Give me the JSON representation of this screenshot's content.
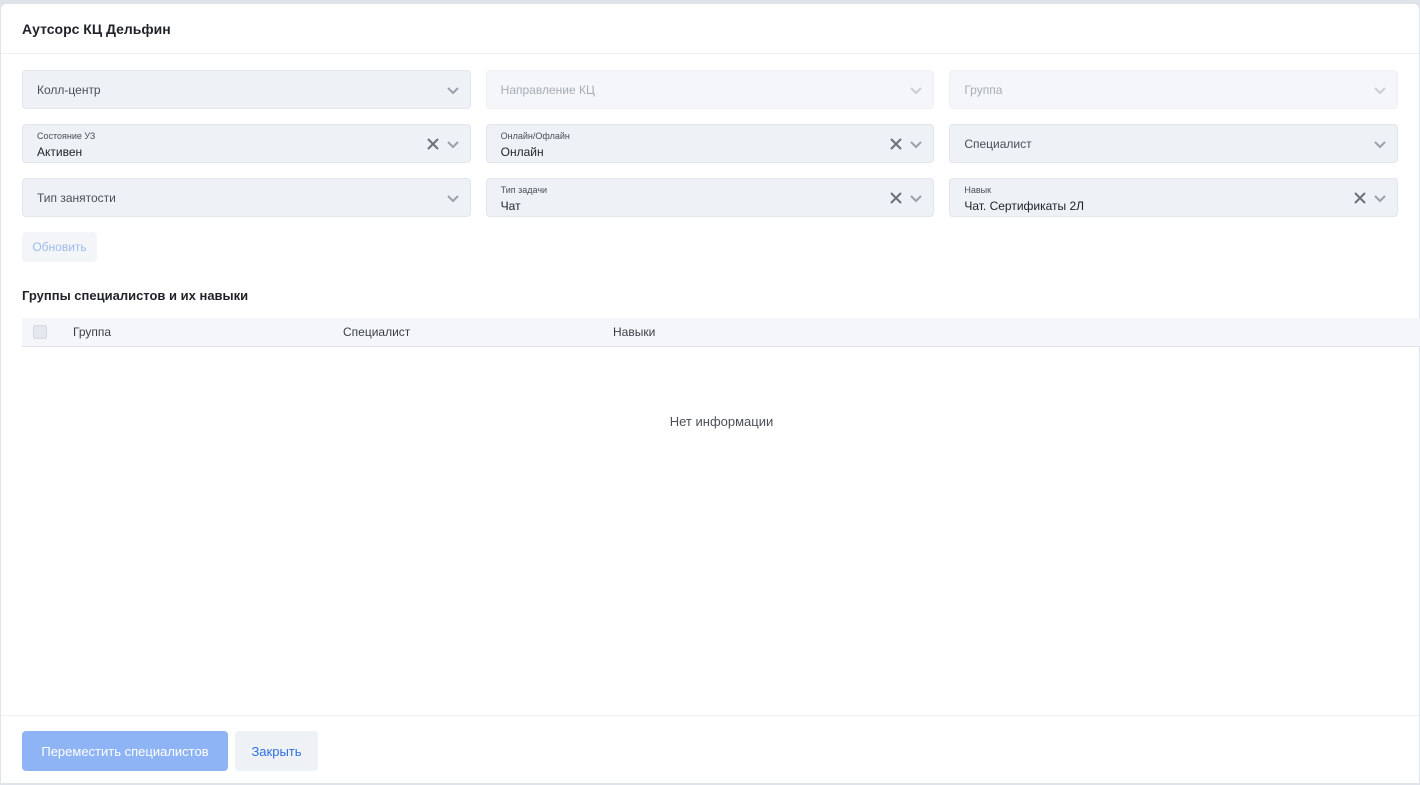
{
  "modal": {
    "title": "Аутсорс КЦ Дельфин"
  },
  "filters": {
    "call_center": {
      "placeholder": "Колл-центр"
    },
    "direction": {
      "placeholder": "Направление КЦ"
    },
    "group": {
      "placeholder": "Группа"
    },
    "state": {
      "label": "Состояние УЗ",
      "value": "Активен"
    },
    "online": {
      "label": "Онлайн/Офлайн",
      "value": "Онлайн"
    },
    "specialist": {
      "placeholder": "Специалист"
    },
    "employment": {
      "placeholder": "Тип занятости"
    },
    "task_type": {
      "label": "Тип задачи",
      "value": "Чат"
    },
    "skill": {
      "label": "Навык",
      "value": "Чат. Сертификаты 2Л"
    }
  },
  "refresh_label": "Обновить",
  "section_title": "Группы специалистов и их навыки",
  "table": {
    "columns": [
      "Группа",
      "Специалист",
      "Навыки"
    ],
    "empty_text": "Нет информации"
  },
  "footer": {
    "move_label": "Переместить специалистов",
    "close_label": "Закрыть"
  },
  "icons": {
    "chevron": "chevron-down-icon",
    "clear": "close-icon"
  },
  "colors": {
    "primary_disabled": "#8fb4f6",
    "link": "#2f6fe0"
  }
}
